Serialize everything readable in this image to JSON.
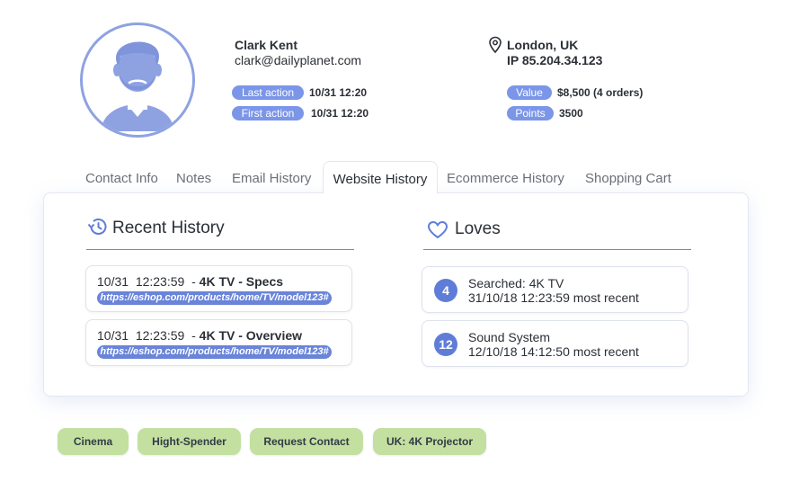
{
  "profile": {
    "name": "Clark Kent",
    "email": "clark@dailyplanet.com",
    "location": "London, UK",
    "ip": "IP 85.204.34.123",
    "last_action_label": "Last action",
    "last_action_value": "10/31 12:20",
    "first_action_label": "First action",
    "first_action_value": "10/31 12:20",
    "value_label": "Value",
    "value_value": "$8,500 (4 orders)",
    "points_label": "Points",
    "points_value": "3500"
  },
  "tabs": [
    {
      "label": "Contact Info"
    },
    {
      "label": "Notes"
    },
    {
      "label": "Email History"
    },
    {
      "label": "Website History"
    },
    {
      "label": "Ecommerce History"
    },
    {
      "label": "Shopping Cart"
    }
  ],
  "active_tab": "Website History",
  "recent_history": {
    "title": "Recent History",
    "items": [
      {
        "time": "10/31  12:23:59",
        "sep": "  - ",
        "title": "4K TV - Specs",
        "url": "https://eshop.com/products/home/TV/model123#"
      },
      {
        "time": "10/31  12:23:59",
        "sep": "  - ",
        "title": "4K TV - Overview",
        "url": "https://eshop.com/products/home/TV/model123#"
      }
    ]
  },
  "loves": {
    "title": "Loves",
    "items": [
      {
        "count": "4",
        "title": "Searched: 4K TV",
        "sub": "31/10/18 12:23:59 most recent"
      },
      {
        "count": "12",
        "title": "Sound System",
        "sub": "12/10/18 14:12:50 most recent"
      }
    ]
  },
  "tags": [
    "Cinema",
    "Hight-Spender",
    "Request Contact",
    "UK: 4K Projector"
  ],
  "icons": {
    "avatar": "user-avatar-icon",
    "location": "map-pin-icon",
    "history": "history-icon",
    "loves": "heart-icon"
  },
  "colors": {
    "accent": "#7b96e8",
    "badge": "#5f7dd8",
    "tag": "#c3e0a0"
  }
}
